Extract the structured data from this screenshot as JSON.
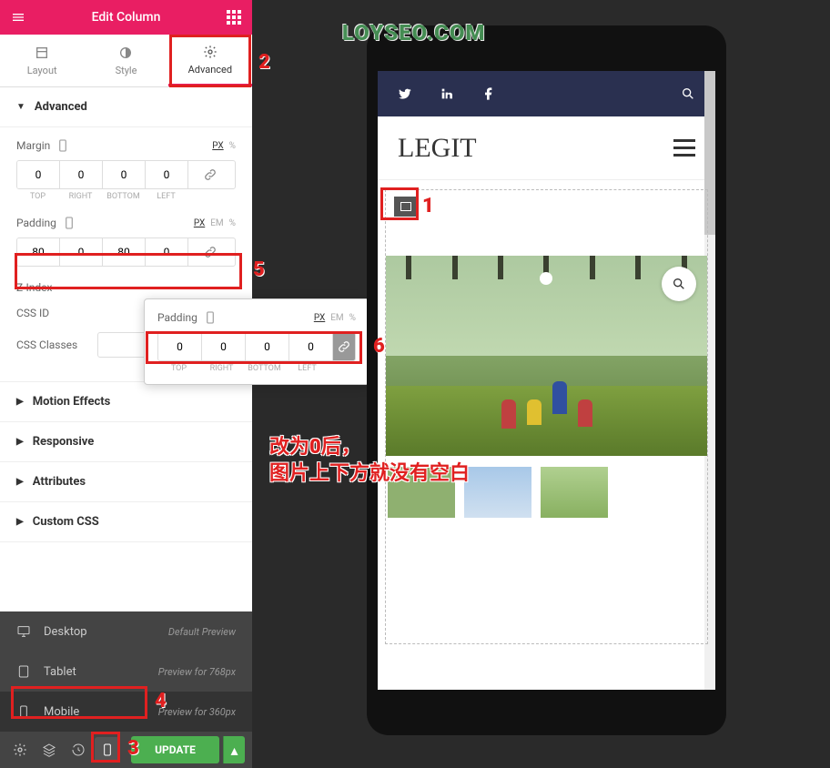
{
  "header": {
    "title": "Edit Column"
  },
  "tabs": {
    "layout": "Layout",
    "style": "Style",
    "advanced": "Advanced"
  },
  "sections": {
    "advanced": {
      "title": "Advanced",
      "margin": {
        "label": "Margin",
        "units": [
          "PX",
          "%"
        ],
        "active_unit": "PX",
        "top": "0",
        "right": "0",
        "bottom": "0",
        "left": "0",
        "sub": [
          "TOP",
          "RIGHT",
          "BOTTOM",
          "LEFT"
        ]
      },
      "padding": {
        "label": "Padding",
        "units": [
          "PX",
          "EM",
          "%"
        ],
        "active_unit": "PX",
        "top": "80",
        "right": "0",
        "bottom": "80",
        "left": "0"
      },
      "zindex": {
        "label": "Z-Index",
        "value": ""
      },
      "cssid": {
        "label": "CSS ID",
        "value": ""
      },
      "cssclasses": {
        "label": "CSS Classes",
        "value": ""
      }
    },
    "motion": "Motion Effects",
    "responsive": "Responsive",
    "attributes": "Attributes",
    "customcss": "Custom CSS"
  },
  "popup": {
    "label": "Padding",
    "units": [
      "PX",
      "EM",
      "%"
    ],
    "active_unit": "PX",
    "top": "0",
    "right": "0",
    "bottom": "0",
    "left": "0",
    "sub": [
      "TOP",
      "RIGHT",
      "BOTTOM",
      "LEFT"
    ]
  },
  "responsive_menu": {
    "desktop": {
      "label": "Desktop",
      "hint": "Default Preview"
    },
    "tablet": {
      "label": "Tablet",
      "hint": "Preview for 768px"
    },
    "mobile": {
      "label": "Mobile",
      "hint": "Preview for 360px"
    }
  },
  "footer": {
    "update": "UPDATE"
  },
  "phone": {
    "brand": "LEGIT"
  },
  "watermark": "LOYSEO.COM",
  "annotations": {
    "a1": "1",
    "a2": "2",
    "a3": "3",
    "a4": "4",
    "a5": "5",
    "a6": "6",
    "note_line1": "改为0后，",
    "note_line2": "图片上下方就没有空白"
  }
}
